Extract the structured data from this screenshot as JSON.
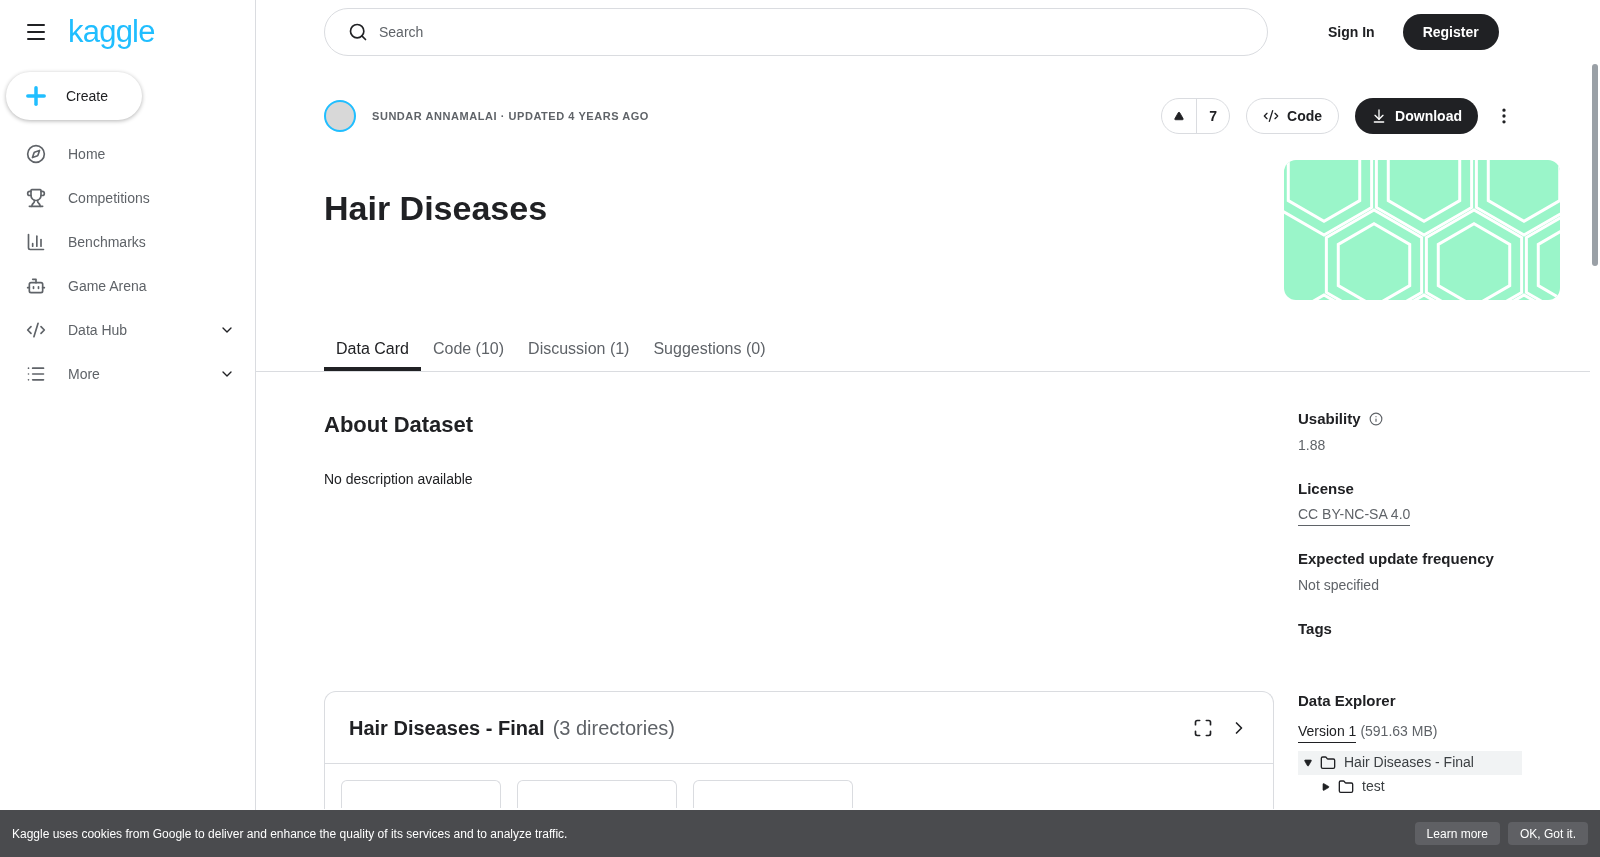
{
  "sidebar": {
    "logo": "kaggle",
    "create_button": "Create",
    "items": [
      {
        "label": "Home",
        "has_submenu": false
      },
      {
        "label": "Competitions",
        "has_submenu": false
      },
      {
        "label": "Benchmarks",
        "has_submenu": false
      },
      {
        "label": "Game Arena",
        "has_submenu": false
      },
      {
        "label": "Data Hub",
        "has_submenu": true
      },
      {
        "label": "More",
        "has_submenu": true
      }
    ]
  },
  "header": {
    "search": {
      "placeholder": "Search"
    },
    "sign_in": "Sign In",
    "register": "Register"
  },
  "dataset": {
    "byline": "SUNDAR ANNAMALAI · UPDATED 4 YEARS AGO",
    "upvotes": "7",
    "code_button": "Code",
    "download_button": "Download",
    "title": "Hair Diseases",
    "tabs": [
      {
        "label": "Data Card",
        "selected": true
      },
      {
        "label": "Code (10)",
        "selected": false
      },
      {
        "label": "Discussion (1)",
        "selected": false
      },
      {
        "label": "Suggestions (0)",
        "selected": false
      }
    ]
  },
  "about": {
    "heading": "About Dataset",
    "description": "No description available"
  },
  "metadata": [
    {
      "label": "Usability",
      "value": "1.88",
      "kind": "info"
    },
    {
      "label": "License",
      "value": "CC BY-NC-SA 4.0",
      "kind": "link"
    },
    {
      "label": "Expected update frequency",
      "value": "Not specified",
      "kind": "text"
    },
    {
      "label": "Tags",
      "kind": "text"
    }
  ],
  "data_explorer": {
    "heading": "Data Explorer",
    "version_link": "Version 1",
    "size": "(591.63 MB)",
    "tree": [
      {
        "name": "Hair Diseases - Final",
        "expanded": true,
        "selected": true,
        "children": [
          {
            "name": "test",
            "expanded": false,
            "selected": false
          }
        ]
      }
    ]
  },
  "file_panel": {
    "title": "Hair Diseases - Final",
    "count": "(3 directories)",
    "cards": [
      {
        "kind": "placeholder"
      },
      {
        "kind": "placeholder"
      },
      {
        "kind": "placeholder"
      }
    ]
  },
  "cookie_banner": {
    "text": "Kaggle uses cookies from Google to deliver and enhance the quality of its services and to analyze traffic.",
    "buttons": [
      "Learn more",
      "OK, Got it."
    ]
  }
}
